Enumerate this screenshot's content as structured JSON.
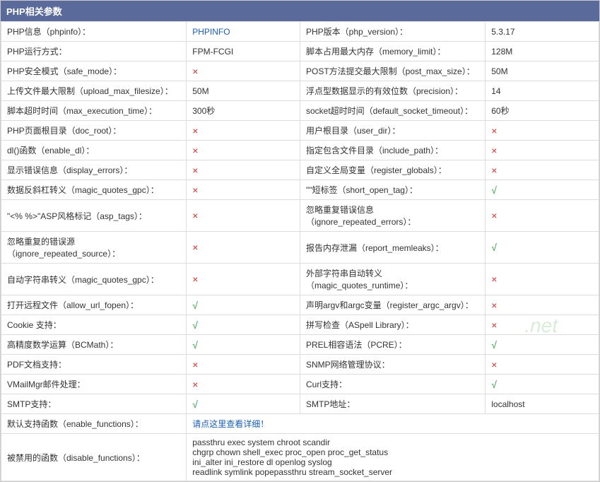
{
  "header": "PHP相关参数",
  "rows": [
    [
      {
        "label": "PHP信息（phpinfo）：",
        "value": "PHPINFO",
        "type": "link"
      },
      {
        "label": "PHP版本（php_version）：",
        "value": "5.3.17",
        "type": "text"
      }
    ],
    [
      {
        "label": "PHP运行方式：",
        "value": "FPM-FCGI",
        "type": "text"
      },
      {
        "label": "脚本占用最大内存（memory_limit）：",
        "value": "128M",
        "type": "text"
      }
    ],
    [
      {
        "label": "PHP安全模式（safe_mode）：",
        "value": "×",
        "type": "cross"
      },
      {
        "label": "POST方法提交最大限制（post_max_size）：",
        "value": "50M",
        "type": "text"
      }
    ],
    [
      {
        "label": "上传文件最大限制（upload_max_filesize）：",
        "value": "50M",
        "type": "text"
      },
      {
        "label": "浮点型数据显示的有效位数（precision）：",
        "value": "14",
        "type": "text"
      }
    ],
    [
      {
        "label": "脚本超时时间（max_execution_time）：",
        "value": "300秒",
        "type": "text"
      },
      {
        "label": "socket超时时间（default_socket_timeout）：",
        "value": "60秒",
        "type": "text"
      }
    ],
    [
      {
        "label": "PHP页面根目录（doc_root）：",
        "value": "×",
        "type": "cross"
      },
      {
        "label": "用户根目录（user_dir）：",
        "value": "×",
        "type": "cross"
      }
    ],
    [
      {
        "label": "dl()函数（enable_dl）：",
        "value": "×",
        "type": "cross"
      },
      {
        "label": "指定包含文件目录（include_path）：",
        "value": "×",
        "type": "cross"
      }
    ],
    [
      {
        "label": "显示错误信息（display_errors）：",
        "value": "×",
        "type": "cross"
      },
      {
        "label": "自定义全局变量（register_globals）：",
        "value": "×",
        "type": "cross"
      }
    ],
    [
      {
        "label": "数据反斜杠转义（magic_quotes_gpc）：",
        "value": "×",
        "type": "cross"
      },
      {
        "label": "\"<?...?>\"短标签（short_open_tag）：",
        "value": "√",
        "type": "check"
      }
    ],
    [
      {
        "label": "\"<% %>\"ASP风格标记（asp_tags）：",
        "value": "×",
        "type": "cross"
      },
      {
        "label": "忽略重复错误信息（ignore_repeated_errors）：",
        "value": "×",
        "type": "cross"
      }
    ],
    [
      {
        "label": "忽略重复的错误源（ignore_repeated_source）：",
        "value": "×",
        "type": "cross"
      },
      {
        "label": "报告内存泄漏（report_memleaks）：",
        "value": "√",
        "type": "check"
      }
    ],
    [
      {
        "label": "自动字符串转义（magic_quotes_gpc）：",
        "value": "×",
        "type": "cross"
      },
      {
        "label": "外部字符串自动转义（magic_quotes_runtime）：",
        "value": "×",
        "type": "cross"
      }
    ],
    [
      {
        "label": "打开远程文件（allow_url_fopen）：",
        "value": "√",
        "type": "check"
      },
      {
        "label": "声明argv和argc变量（register_argc_argv）：",
        "value": "×",
        "type": "cross"
      }
    ],
    [
      {
        "label": "Cookie 支持：",
        "value": "√",
        "type": "check"
      },
      {
        "label": "拼写检查（ASpell Library）：",
        "value": "×",
        "type": "cross"
      }
    ],
    [
      {
        "label": "高精度数学运算（BCMath）：",
        "value": "√",
        "type": "check"
      },
      {
        "label": "PREL相容语法（PCRE）：",
        "value": "√",
        "type": "check"
      }
    ],
    [
      {
        "label": "PDF文档支持：",
        "value": "×",
        "type": "cross"
      },
      {
        "label": "SNMP网络管理协议：",
        "value": "×",
        "type": "cross"
      }
    ],
    [
      {
        "label": "VMailMgr邮件处理：",
        "value": "×",
        "type": "cross"
      },
      {
        "label": "Curl支持：",
        "value": "√",
        "type": "check"
      }
    ],
    [
      {
        "label": "SMTP支持：",
        "value": "√",
        "type": "check"
      },
      {
        "label": "SMTP地址：",
        "value": "localhost",
        "type": "text"
      }
    ]
  ],
  "fullrows": [
    {
      "label": "默认支持函数（enable_functions）：",
      "value": "请点这里查看详细！",
      "type": "link"
    },
    {
      "label": "被禁用的函数（disable_functions）：",
      "value": "passthru  exec  system  chroot  scandir\nchgrp  chown  shell_exec  proc_open  proc_get_status\nini_alter  ini_restore  dl  openlog  syslog\nreadlink  symlink  popepassthru  stream_socket_server",
      "type": "text"
    }
  ],
  "watermark": ".net"
}
